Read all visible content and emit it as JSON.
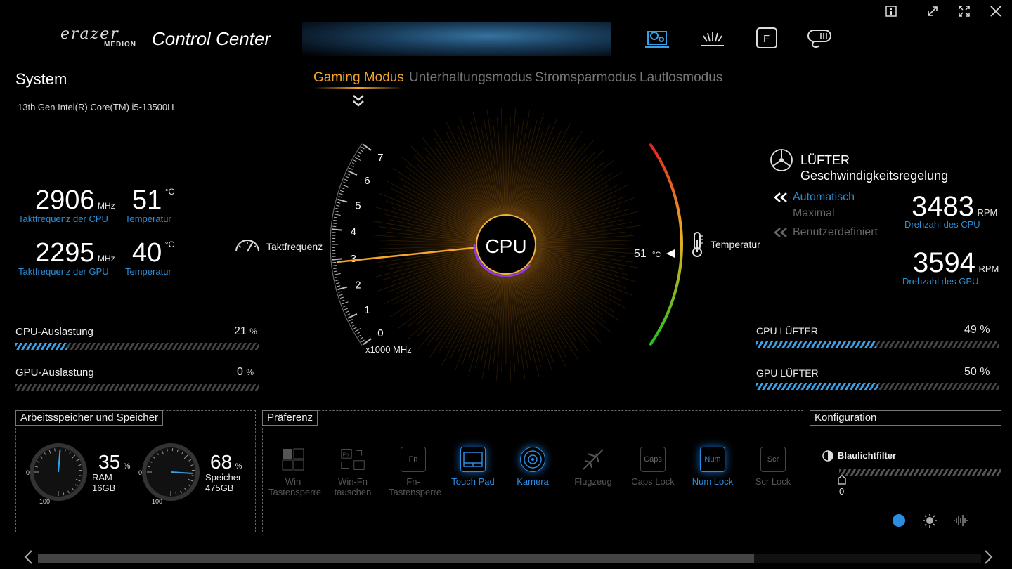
{
  "window": {
    "buttons": [
      "info-icon",
      "restore-icon",
      "fullscreen-icon",
      "close-icon"
    ]
  },
  "header": {
    "brand": "erazer",
    "brand_sub": "MEDION",
    "title": "Control Center",
    "nav_icons": [
      "system-monitor-icon",
      "lighting-icon",
      "function-key-icon",
      "macro-icon"
    ]
  },
  "system": {
    "title": "System",
    "cpu_name": "13th Gen Intel(R) Core(TM) i5-13500H",
    "cpu_freq": "2906",
    "cpu_freq_unit": "MHz",
    "cpu_freq_label": "Taktfrequenz der CPU",
    "cpu_temp": "51",
    "cpu_temp_unit": "°C",
    "cpu_temp_label": "Temperatur",
    "gpu_freq": "2295",
    "gpu_freq_unit": "MHz",
    "gpu_freq_label": "Taktfrequenz der GPU",
    "gpu_temp": "40",
    "gpu_temp_unit": "°C",
    "gpu_temp_label": "Temperatur",
    "cpu_load_label": "CPU-Auslastung",
    "cpu_load": "21",
    "cpu_load_unit": "%",
    "cpu_load_fraction": 0.21,
    "gpu_load_label": "GPU-Auslastung",
    "gpu_load": "0",
    "gpu_load_unit": "%",
    "gpu_load_fraction": 0.0
  },
  "modes": {
    "items": [
      "Gaming Modus",
      "Unterhaltungsmodus",
      "Stromsparmodus",
      "Lautlosmodus"
    ],
    "active": "Gaming Modus"
  },
  "gauge": {
    "center_label": "CPU",
    "freq_label": "Taktfrequenz",
    "temp_label": "Temperatur",
    "ticks": [
      "0",
      "1",
      "2",
      "3",
      "4",
      "5",
      "6",
      "7"
    ],
    "scale_label": "x1000 MHz",
    "temp_value": "51",
    "temp_unit": "°C",
    "freq_value_ghz": 2.906
  },
  "fan": {
    "title1": "LÜFTER",
    "title2": "Geschwindigkeitsregelung",
    "opt_auto": "Automatisch",
    "opt_max": "Maximal",
    "opt_custom": "Benutzerdefiniert",
    "cpu_rpm": "3483",
    "gpu_rpm": "3594",
    "rpm_unit": "RPM",
    "cpu_rpm_label": "Drehzahl des CPU-",
    "gpu_rpm_label": "Drehzahl des GPU-",
    "cpu_fan_label": "CPU LÜFTER",
    "cpu_fan": "49 %",
    "cpu_fan_fraction": 0.49,
    "gpu_fan_label": "GPU LÜFTER",
    "gpu_fan": "50 %",
    "gpu_fan_fraction": 0.5
  },
  "memory": {
    "title": "Arbeitsspeicher und Speicher",
    "ram_pct": "35",
    "ram_unit": "%",
    "ram_label": "RAM",
    "ram_size": "16GB",
    "ram_fraction": 0.35,
    "disk_pct": "68",
    "disk_unit": "%",
    "disk_label": "Speicher",
    "disk_size": "475GB",
    "disk_fraction": 0.68,
    "dial_min": "0",
    "dial_max": "100"
  },
  "preference": {
    "title": "Präferenz",
    "items": [
      {
        "l1": "Win",
        "l2": "Tastensperre",
        "icon": "win-key-icon",
        "on": false
      },
      {
        "l1": "Win-Fn",
        "l2": "tauschen",
        "icon": "swap-icon",
        "on": false
      },
      {
        "l1": "Fn-",
        "l2": "Tastensperre",
        "icon": "fn-lock-icon",
        "glyph": "Fn",
        "on": false
      },
      {
        "l1": "Touch Pad",
        "l2": "",
        "icon": "touchpad-icon",
        "on": true
      },
      {
        "l1": "Kamera",
        "l2": "",
        "icon": "camera-icon",
        "on": true
      },
      {
        "l1": "Flugzeug",
        "l2": "",
        "icon": "airplane-icon",
        "on": false
      },
      {
        "l1": "Caps Lock",
        "l2": "",
        "icon": "caps-lock-icon",
        "glyph": "Caps",
        "on": false
      },
      {
        "l1": "Num Lock",
        "l2": "",
        "icon": "num-lock-icon",
        "glyph": "Num",
        "on": true
      },
      {
        "l1": "Scr Lock",
        "l2": "",
        "icon": "scroll-lock-icon",
        "glyph": "Scr",
        "on": false
      }
    ]
  },
  "config": {
    "title": "Konfiguration",
    "bluelight_label": "Blaulichtfilter",
    "bluelight_value": "0",
    "icons": [
      "night-mode-icon",
      "brightness-icon",
      "sound-icon"
    ]
  },
  "colors": {
    "accent": "#f5a52b",
    "blue": "#2c8fd8"
  }
}
